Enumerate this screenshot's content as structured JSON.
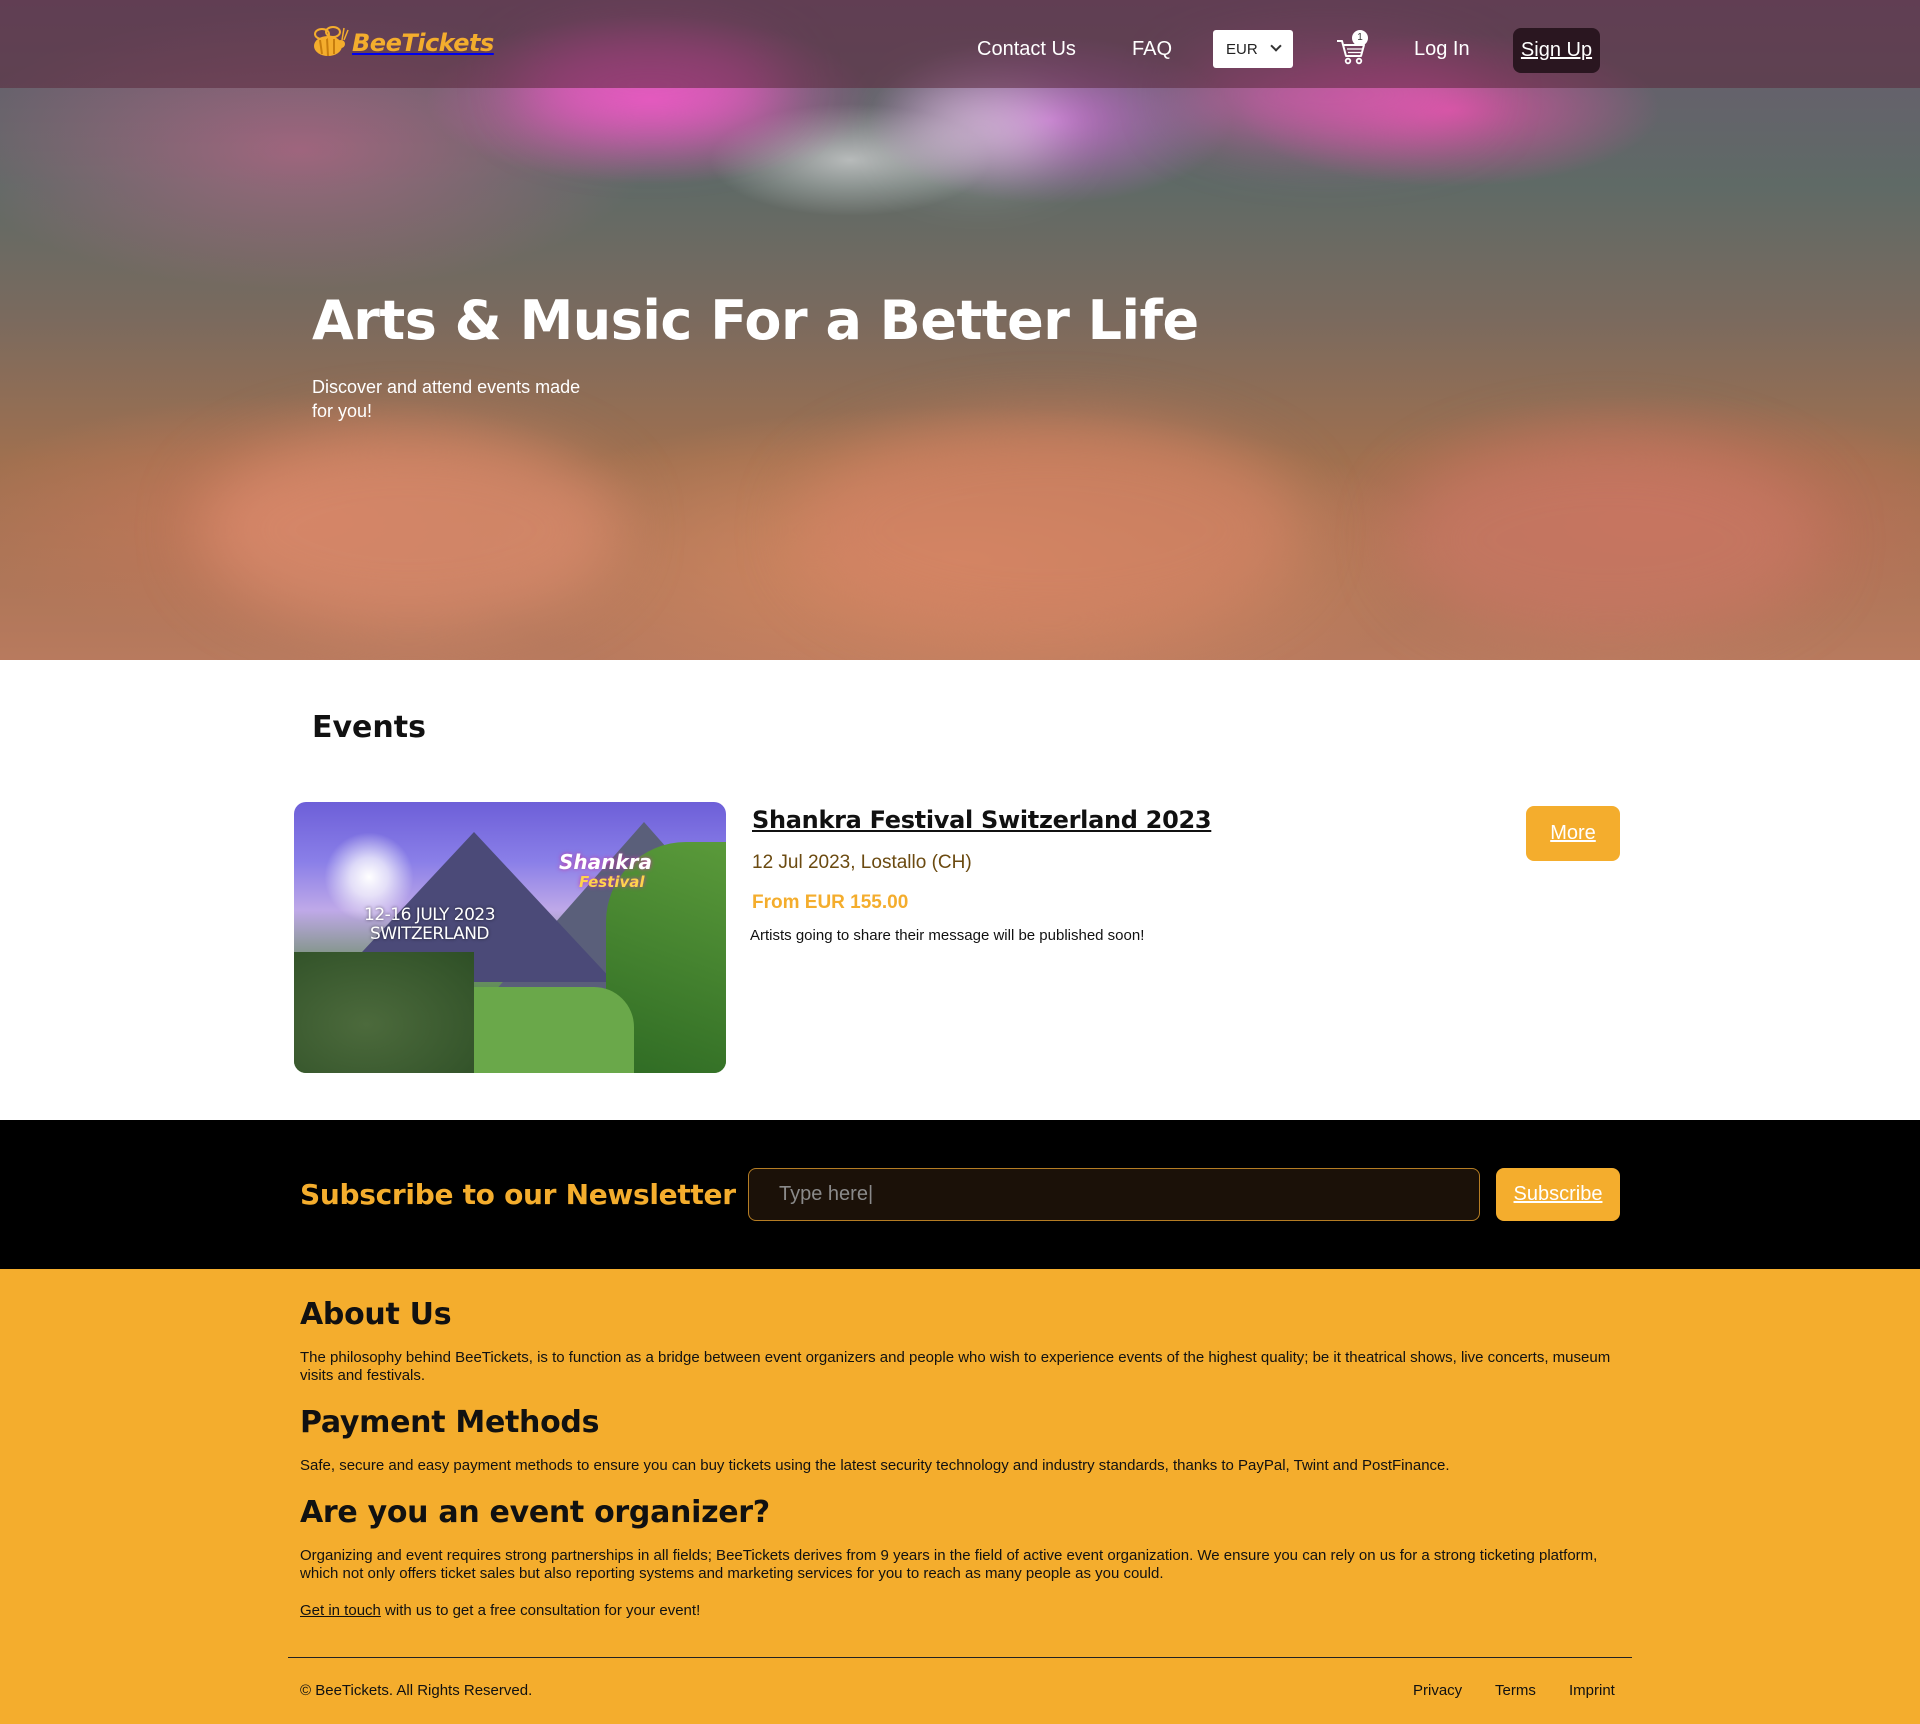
{
  "brand": {
    "name": "BeeTickets",
    "accent": "#f4ad2d"
  },
  "nav": {
    "contact_label": "Contact Us",
    "faq_label": "FAQ",
    "currency": "EUR",
    "cart_count": "1",
    "login_label": "Log In",
    "signup_label": "Sign Up"
  },
  "hero": {
    "title": "Arts & Music For a Better Life",
    "subtitle": "Discover and attend events made for you!"
  },
  "events": {
    "heading": "Events",
    "items": [
      {
        "image_date_text_line1": "12-16 JULY 2023",
        "image_date_text_line2": "SWITZERLAND",
        "image_logo_text": "Shankra",
        "image_logo_sub": "Festival",
        "title": "Shankra Festival Switzerland 2023",
        "date_location": "12 Jul 2023, Lostallo (CH)",
        "price": "From EUR 155.00",
        "description": "Artists going to share their message will be published soon!",
        "more_label": "More"
      }
    ]
  },
  "newsletter": {
    "title": "Subscribe to our Newsletter",
    "placeholder": "Type here|",
    "button_label": "Subscribe"
  },
  "footer": {
    "about_title": "About Us",
    "about_text": "The philosophy behind BeeTickets, is to function as a bridge between event organizers and people who wish to experience events of the highest quality; be it theatrical shows, live concerts, museum visits and festivals.",
    "payment_title": "Payment Methods",
    "payment_text": "Safe, secure and easy payment methods to ensure you can buy tickets using the latest security technology and industry standards, thanks to PayPal, Twint and PostFinance.",
    "organizer_title": "Are you an event organizer?",
    "organizer_text": "Organizing and event requires strong partnerships in all fields; BeeTickets derives from 9 years in the field of active event organization. We ensure you can rely on us for a strong ticketing platform, which not only offers ticket sales but also reporting systems and marketing services for you to reach as many people as you could.",
    "contact_link_label": "Get in touch",
    "contact_text": " with us to get a free consultation for your event!",
    "copyright": "© BeeTickets. All Rights Reserved.",
    "links": {
      "privacy": "Privacy",
      "terms": "Terms",
      "imprint": "Imprint"
    }
  }
}
